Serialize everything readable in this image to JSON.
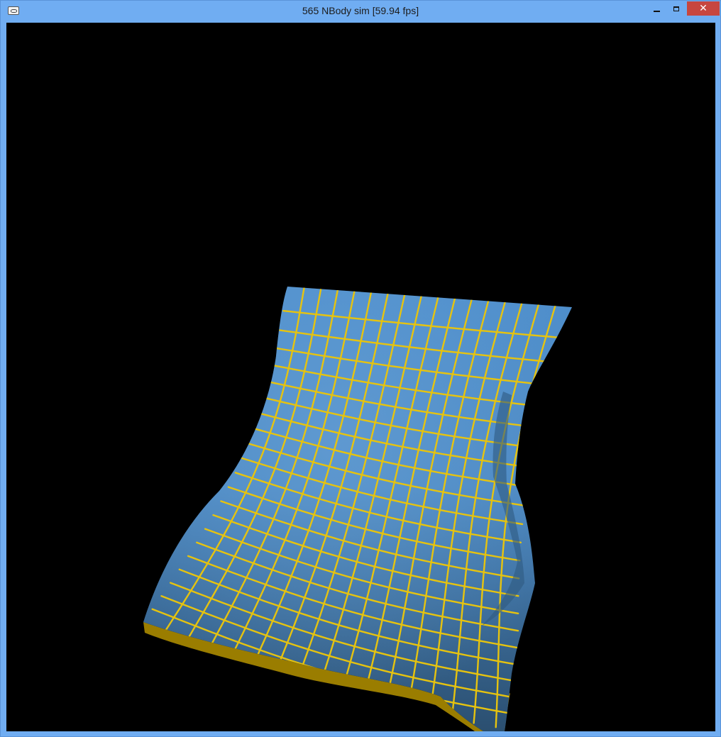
{
  "window": {
    "title": "565 NBody sim [59.94 fps]",
    "icons": {
      "app": "app-window-icon",
      "minimize": "minimize-icon",
      "maximize": "maximize-icon",
      "close": "close-icon"
    },
    "close_glyph": "✕"
  },
  "scene": {
    "colors": {
      "background": "#000000",
      "cloth_light": "#4f8fcc",
      "cloth_dark": "#2b4f70",
      "grid_lines": "#e6c30f",
      "cloth_edge": "#9a7d00",
      "close_button": "#c7463f",
      "frame": "#70adf2"
    }
  }
}
